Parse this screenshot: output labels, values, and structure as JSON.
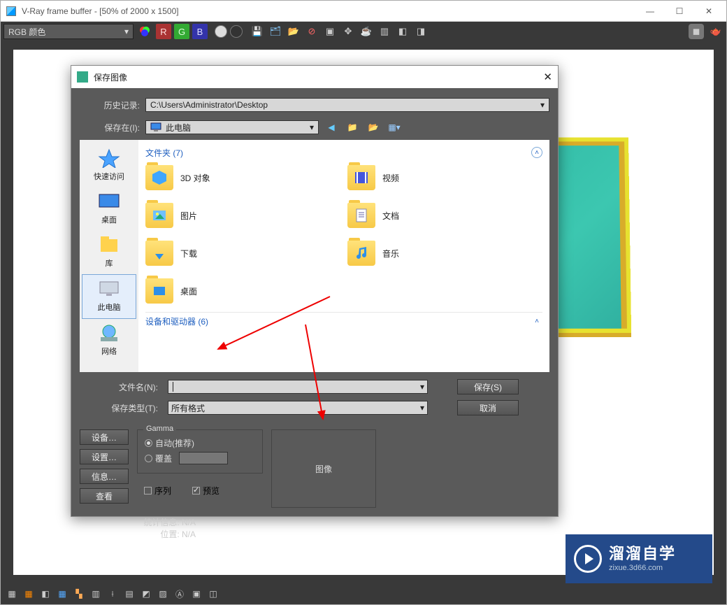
{
  "window": {
    "title": "V-Ray frame buffer - [50% of 2000 x 1500]"
  },
  "toolbar": {
    "channel": "RGB 颜色",
    "r": "R",
    "g": "G",
    "b": "B"
  },
  "statusbar_icons": [
    "□",
    "⊞",
    "◧",
    "▦",
    "⟂",
    "⊔",
    "⟊",
    "◫",
    "◨",
    "▨",
    "◩",
    "▤",
    "▥"
  ],
  "save_dialog": {
    "title": "保存图像",
    "history_label": "历史记录:",
    "history_value": "C:\\Users\\Administrator\\Desktop",
    "save_in_label": "保存在(I):",
    "save_in_value": "此电脑",
    "places": [
      {
        "label": "快速访问"
      },
      {
        "label": "桌面"
      },
      {
        "label": "库"
      },
      {
        "label": "此电脑"
      },
      {
        "label": "网络"
      }
    ],
    "folders_header": "文件夹 (7)",
    "folders": [
      {
        "label": "3D 对象",
        "overlay_color": "#3fa6ff"
      },
      {
        "label": "视频",
        "overlay_color": "#ff7a33"
      },
      {
        "label": "图片",
        "overlay_color": "#6fc0ff"
      },
      {
        "label": "文档",
        "overlay_color": "#4a88e0"
      },
      {
        "label": "下载",
        "overlay_color": "#2d8fe8"
      },
      {
        "label": "音乐",
        "overlay_color": "#2d8fe8"
      },
      {
        "label": "桌面",
        "overlay_color": "#2d8fe8"
      }
    ],
    "devices_header": "设备和驱动器 (6)",
    "filename_label": "文件名(N):",
    "filename_value": "",
    "filetype_label": "保存类型(T):",
    "filetype_value": "所有格式",
    "save_btn": "保存(S)",
    "cancel_btn": "取消",
    "side_buttons": [
      "设备…",
      "设置…",
      "信息…",
      "查看"
    ],
    "gamma": {
      "legend": "Gamma",
      "auto": "自动(推荐)",
      "override": "覆盖",
      "sequence": "序列",
      "preview": "预览"
    },
    "image_box_label": "图像",
    "stats_line1": "统计信息: N/A",
    "stats_line2": "位置: N/A"
  },
  "watermark": {
    "text_main": "溜溜自学",
    "text_sub": "zixue.3d66.com"
  }
}
